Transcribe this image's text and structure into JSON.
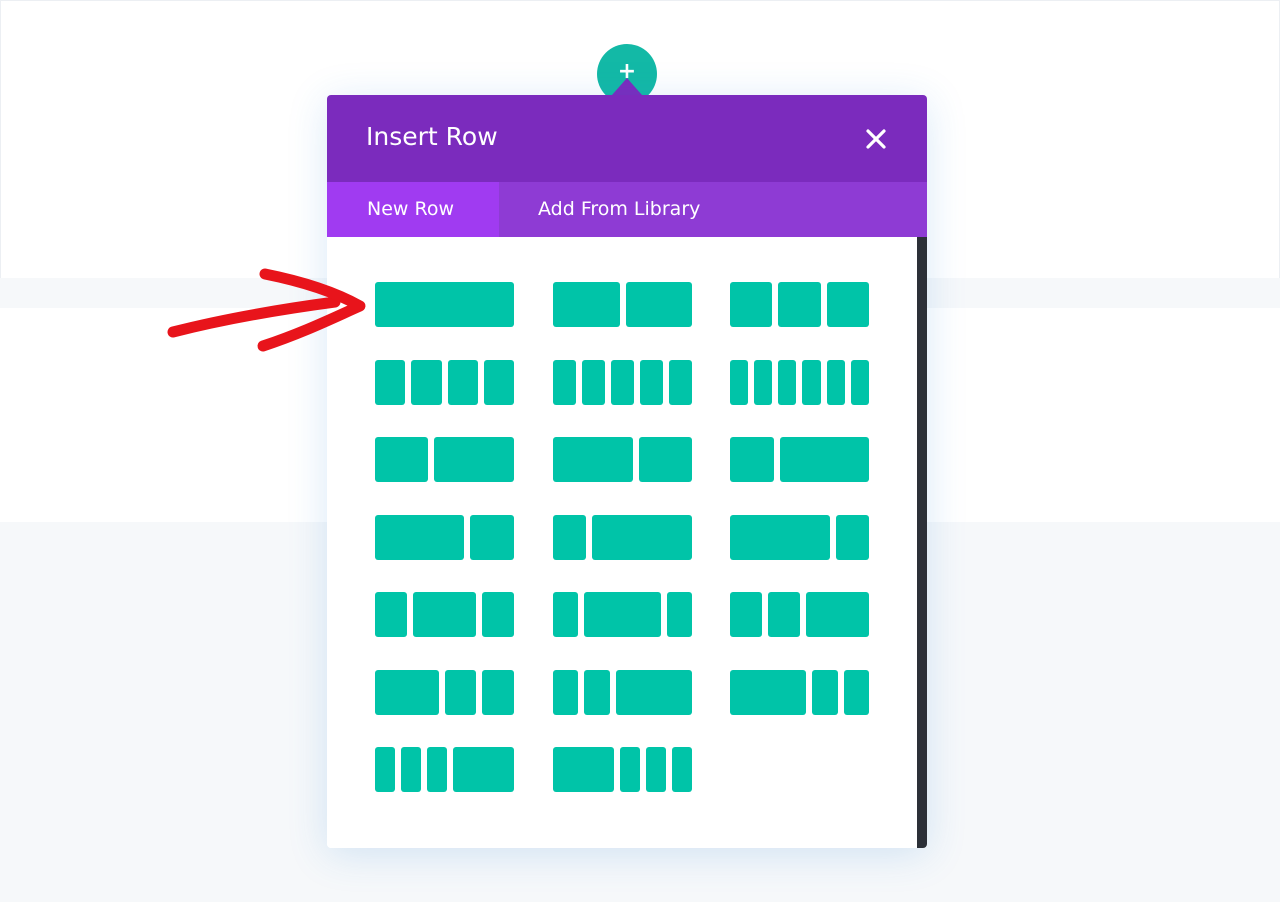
{
  "modal": {
    "title": "Insert Row",
    "tabs": [
      {
        "label": "New Row",
        "active": true
      },
      {
        "label": "Add From Library",
        "active": false
      }
    ]
  },
  "add_button_icon": "plus-icon",
  "close_icon": "close-icon",
  "annotation": "red-arrow-pointing-at-first-layout",
  "colors": {
    "header": "#7b2bbd",
    "tab_bar": "#8e3bd4",
    "active_tab": "#a03bf1",
    "layout_block": "#00c4a8",
    "add_button": "#13b9a6",
    "annotation_arrow": "#e8141b"
  },
  "layouts": [
    {
      "columns": [
        "1"
      ]
    },
    {
      "columns": [
        "1/2",
        "1/2"
      ]
    },
    {
      "columns": [
        "1/3",
        "1/3",
        "1/3"
      ]
    },
    {
      "columns": [
        "1/4",
        "1/4",
        "1/4",
        "1/4"
      ]
    },
    {
      "columns": [
        "1/5",
        "1/5",
        "1/5",
        "1/5",
        "1/5"
      ]
    },
    {
      "columns": [
        "1/6",
        "1/6",
        "1/6",
        "1/6",
        "1/6",
        "1/6"
      ]
    },
    {
      "columns": [
        "2/5",
        "3/5"
      ]
    },
    {
      "columns": [
        "3/5",
        "2/5"
      ]
    },
    {
      "columns": [
        "1/3",
        "2/3"
      ]
    },
    {
      "columns": [
        "2/3",
        "1/3"
      ]
    },
    {
      "columns": [
        "1/4",
        "3/4"
      ]
    },
    {
      "columns": [
        "3/4",
        "1/4"
      ]
    },
    {
      "columns": [
        "1/4",
        "1/2",
        "1/4"
      ]
    },
    {
      "columns": [
        "1/5",
        "3/5",
        "1/5"
      ]
    },
    {
      "columns": [
        "1/4",
        "1/4",
        "1/2"
      ]
    },
    {
      "columns": [
        "1/2",
        "1/4",
        "1/4"
      ]
    },
    {
      "columns": [
        "1/5",
        "1/5",
        "3/5"
      ]
    },
    {
      "columns": [
        "3/5",
        "1/5",
        "1/5"
      ]
    },
    {
      "columns": [
        "1/6",
        "1/6",
        "1/6",
        "1/2"
      ]
    },
    {
      "columns": [
        "1/2",
        "1/6",
        "1/6",
        "1/6"
      ]
    }
  ]
}
